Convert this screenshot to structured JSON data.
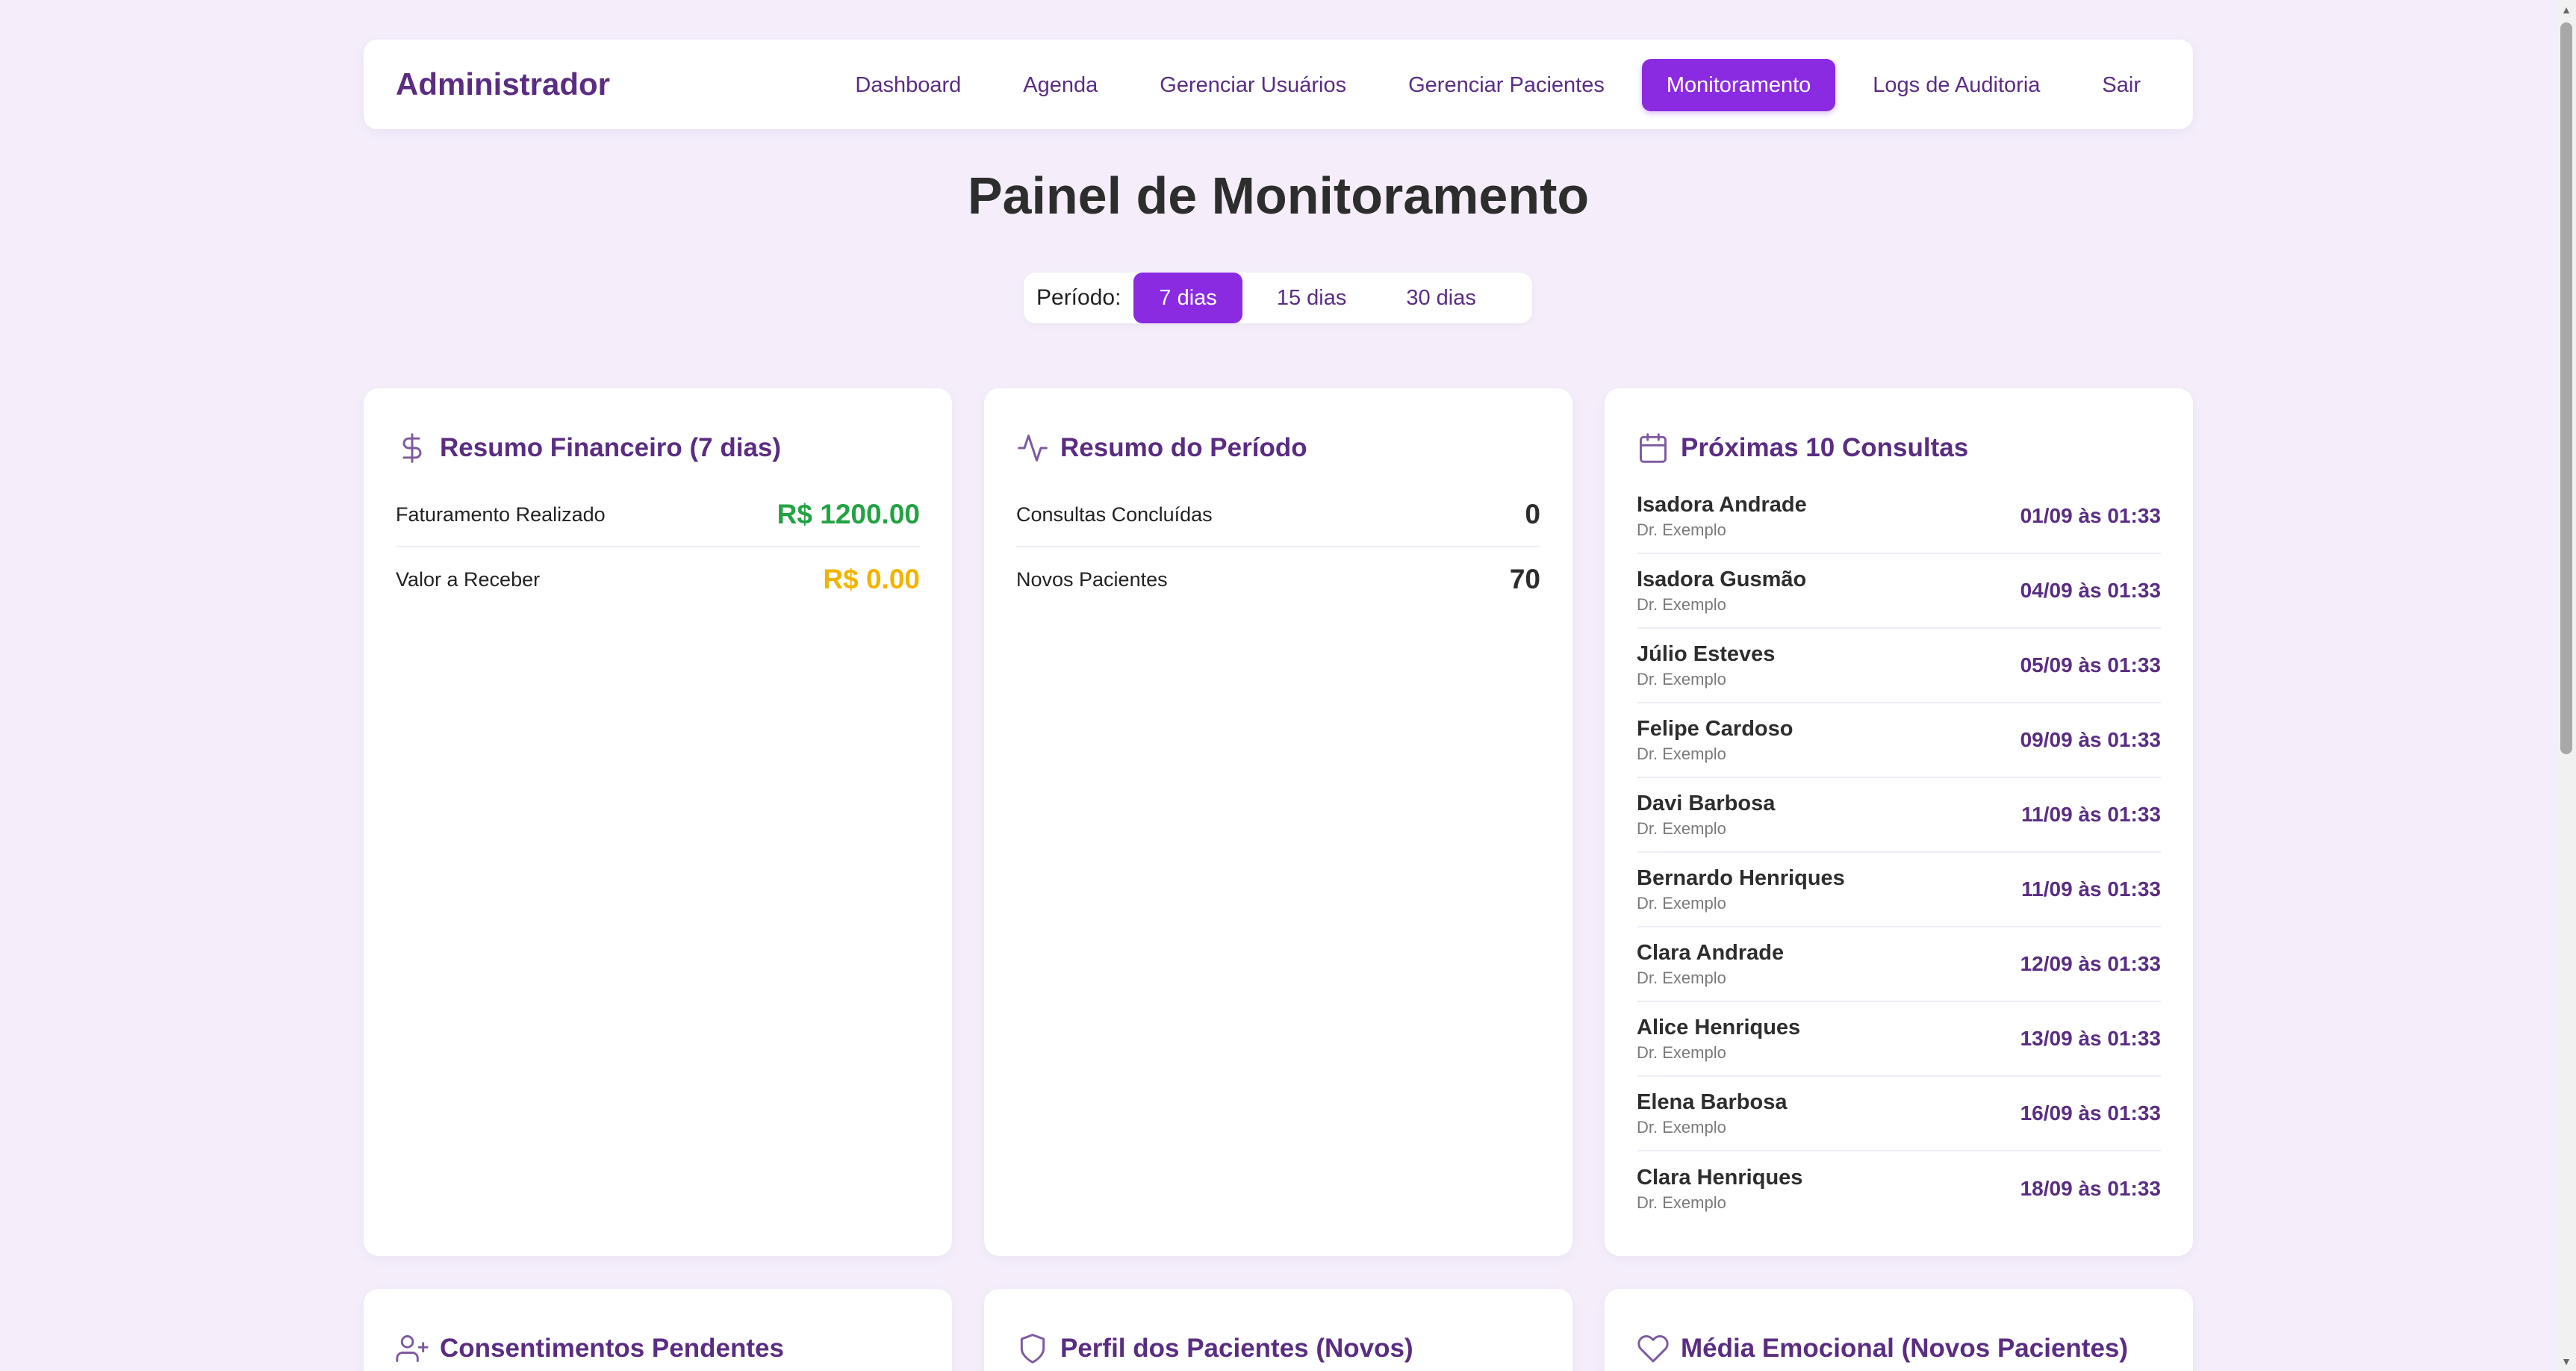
{
  "header": {
    "brand": "Administrador",
    "nav": [
      {
        "label": "Dashboard",
        "active": false
      },
      {
        "label": "Agenda",
        "active": false
      },
      {
        "label": "Gerenciar Usuários",
        "active": false
      },
      {
        "label": "Gerenciar Pacientes",
        "active": false
      },
      {
        "label": "Monitoramento",
        "active": true
      },
      {
        "label": "Logs de Auditoria",
        "active": false
      },
      {
        "label": "Sair",
        "active": false
      }
    ]
  },
  "page_title": "Painel de Monitoramento",
  "period": {
    "label": "Período:",
    "options": [
      "7 dias",
      "15 dias",
      "30 dias"
    ],
    "selected": "7 dias"
  },
  "financial": {
    "title": "Resumo Financeiro (7 dias)",
    "rows": [
      {
        "label": "Faturamento Realizado",
        "value": "R$ 1200.00",
        "color": "#23a343"
      },
      {
        "label": "Valor a Receber",
        "value": "R$ 0.00",
        "color": "#f0b400"
      }
    ]
  },
  "period_summary": {
    "title": "Resumo do Período",
    "rows": [
      {
        "label": "Consultas Concluídas",
        "value": "0"
      },
      {
        "label": "Novos Pacientes",
        "value": "70"
      }
    ]
  },
  "upcoming": {
    "title": "Próximas 10 Consultas",
    "items": [
      {
        "name": "Isadora Andrade",
        "doctor": "Dr. Exemplo",
        "date": "01/09 às 01:33"
      },
      {
        "name": "Isadora Gusmão",
        "doctor": "Dr. Exemplo",
        "date": "04/09 às 01:33"
      },
      {
        "name": "Júlio Esteves",
        "doctor": "Dr. Exemplo",
        "date": "05/09 às 01:33"
      },
      {
        "name": "Felipe Cardoso",
        "doctor": "Dr. Exemplo",
        "date": "09/09 às 01:33"
      },
      {
        "name": "Davi Barbosa",
        "doctor": "Dr. Exemplo",
        "date": "11/09 às 01:33"
      },
      {
        "name": "Bernardo Henriques",
        "doctor": "Dr. Exemplo",
        "date": "11/09 às 01:33"
      },
      {
        "name": "Clara Andrade",
        "doctor": "Dr. Exemplo",
        "date": "12/09 às 01:33"
      },
      {
        "name": "Alice Henriques",
        "doctor": "Dr. Exemplo",
        "date": "13/09 às 01:33"
      },
      {
        "name": "Elena Barbosa",
        "doctor": "Dr. Exemplo",
        "date": "16/09 às 01:33"
      },
      {
        "name": "Clara Henriques",
        "doctor": "Dr. Exemplo",
        "date": "18/09 às 01:33"
      }
    ]
  },
  "bottom_cards": {
    "consents": {
      "title": "Consentimentos Pendentes",
      "icon": "user-plus-icon"
    },
    "profile": {
      "title": "Perfil dos Pacientes (Novos)",
      "icon": "shield-icon"
    },
    "emotional": {
      "title": "Média Emocional (Novos Pacientes)",
      "icon": "heart-icon"
    }
  },
  "colors": {
    "accent": "#8a2be2",
    "brand_text": "#5a2d82",
    "background": "#f5eefa",
    "positive": "#23a343",
    "pending": "#f0b400"
  }
}
